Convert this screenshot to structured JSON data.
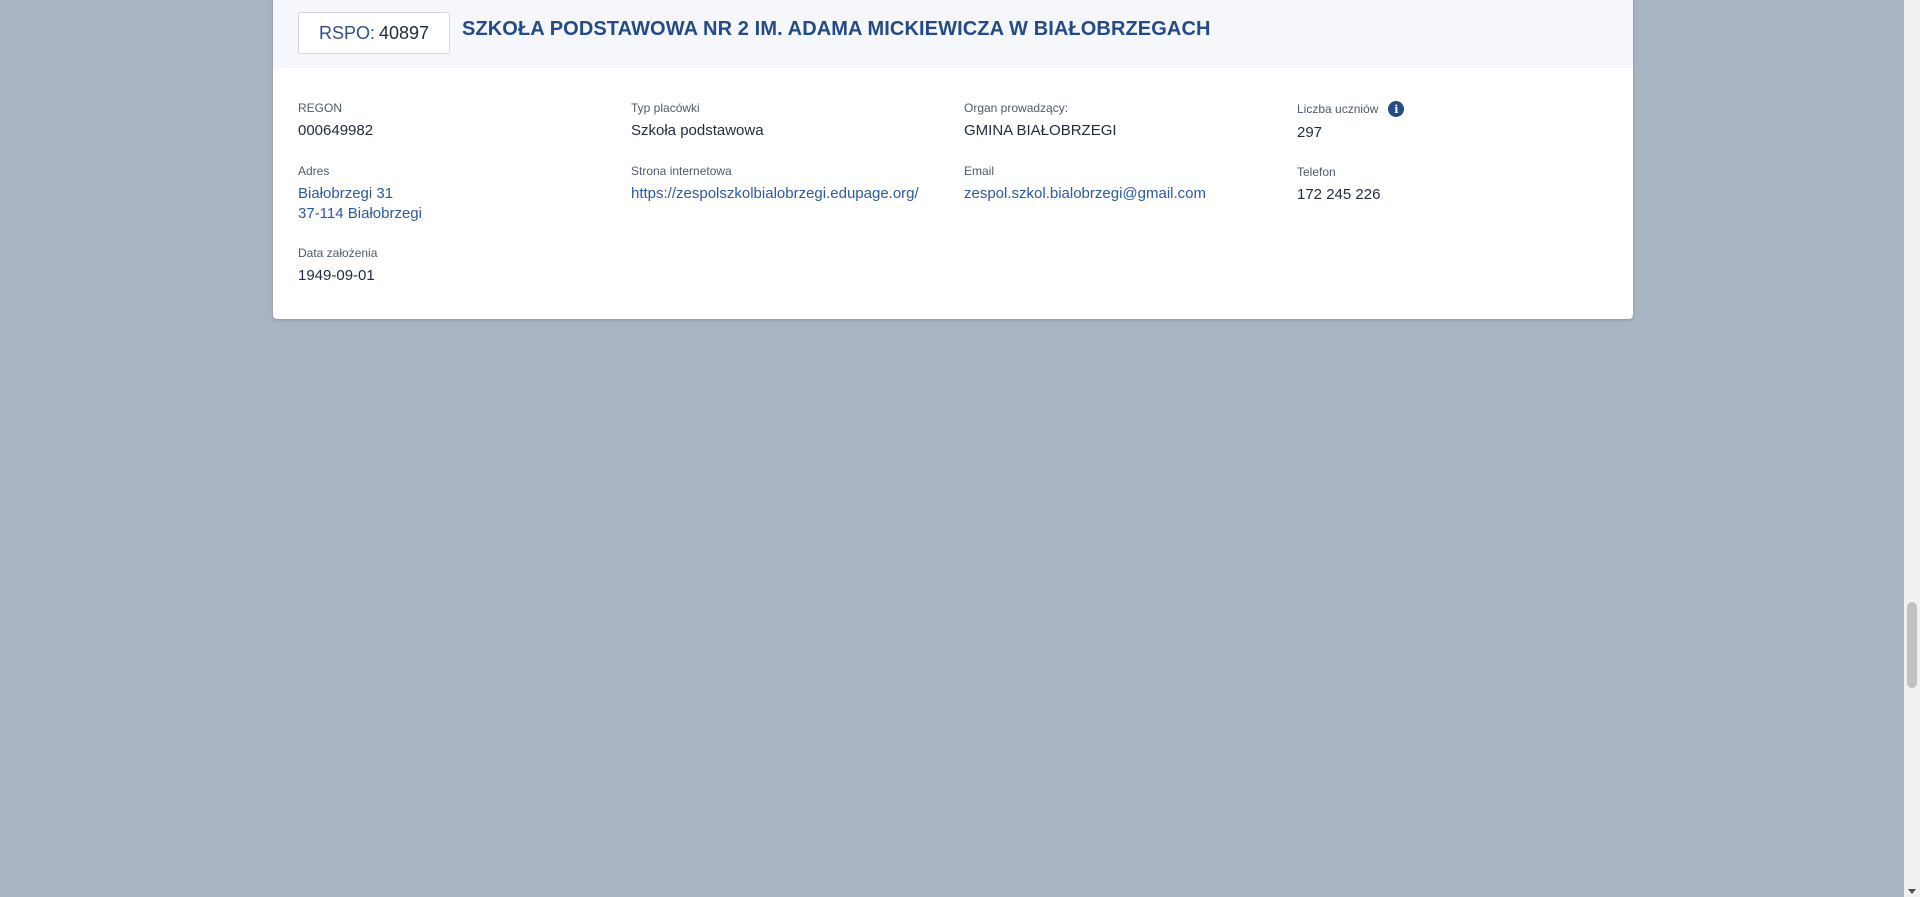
{
  "header": {
    "rspo_label": "RSPO:",
    "rspo_value": "40897",
    "title": "SZKOŁA PODSTAWOWA NR 2 IM. ADAMA MICKIEWICZA W BIAŁOBRZEGACH"
  },
  "fields": {
    "regon": {
      "label": "REGON",
      "value": "000649982"
    },
    "typ": {
      "label": "Typ placówki",
      "value": "Szkoła podstawowa"
    },
    "organ": {
      "label": "Organ prowadzący:",
      "value": "GMINA BIAŁOBRZEGI"
    },
    "uczniowie": {
      "label": "Liczba uczniów",
      "value": "297",
      "icon": "info-icon"
    },
    "adres": {
      "label": "Adres",
      "line1": "Białobrzegi 31",
      "line2": "37-114 Białobrzegi"
    },
    "strona": {
      "label": "Strona internetowa",
      "value": "https://zespolszkolbialobrzegi.edupage.org/"
    },
    "email": {
      "label": "Email",
      "value": "zespol.szkol.bialobrzegi@gmail.com"
    },
    "telefon": {
      "label": "Telefon",
      "value": "172 245 226"
    },
    "data_zalozenia": {
      "label": "Data założenia",
      "value": "1949-09-01"
    }
  },
  "colors": {
    "background": "#a9b4c2",
    "title": "#234b88",
    "link": "#2b5aa0"
  }
}
